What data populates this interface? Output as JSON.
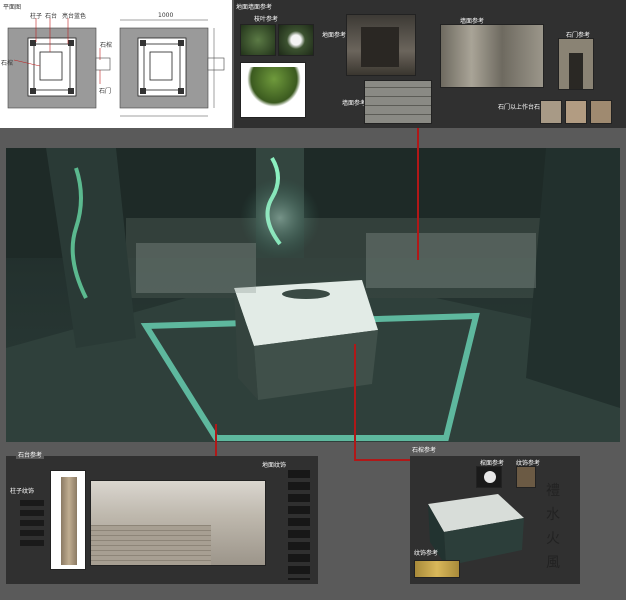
{
  "floor_plan": {
    "title": "平面图",
    "labels": [
      "柱子",
      "石台",
      "亮台蓝色",
      "石棺",
      "石门"
    ],
    "dim_top": "1000"
  },
  "wall_ref": {
    "title": "地面墙面参考",
    "vine_label": "枝叶参考",
    "floor_label": "地面参考",
    "stone_label": "墙面参考",
    "wall_label": "墙面参考",
    "door_label": "石门参考",
    "door_note": "石门以上作台石影响"
  },
  "platform_ref": {
    "title": "石台参考",
    "pillar_label": "柱子纹饰",
    "floor_pattern_label": "地面纹饰"
  },
  "coffin_ref": {
    "title": "石棺参考",
    "top_label": "棺面参考",
    "pattern_label": "纹饰参考",
    "texture_label": "纹饰参考",
    "glyphs": [
      "禮",
      "水",
      "火",
      "風"
    ]
  }
}
